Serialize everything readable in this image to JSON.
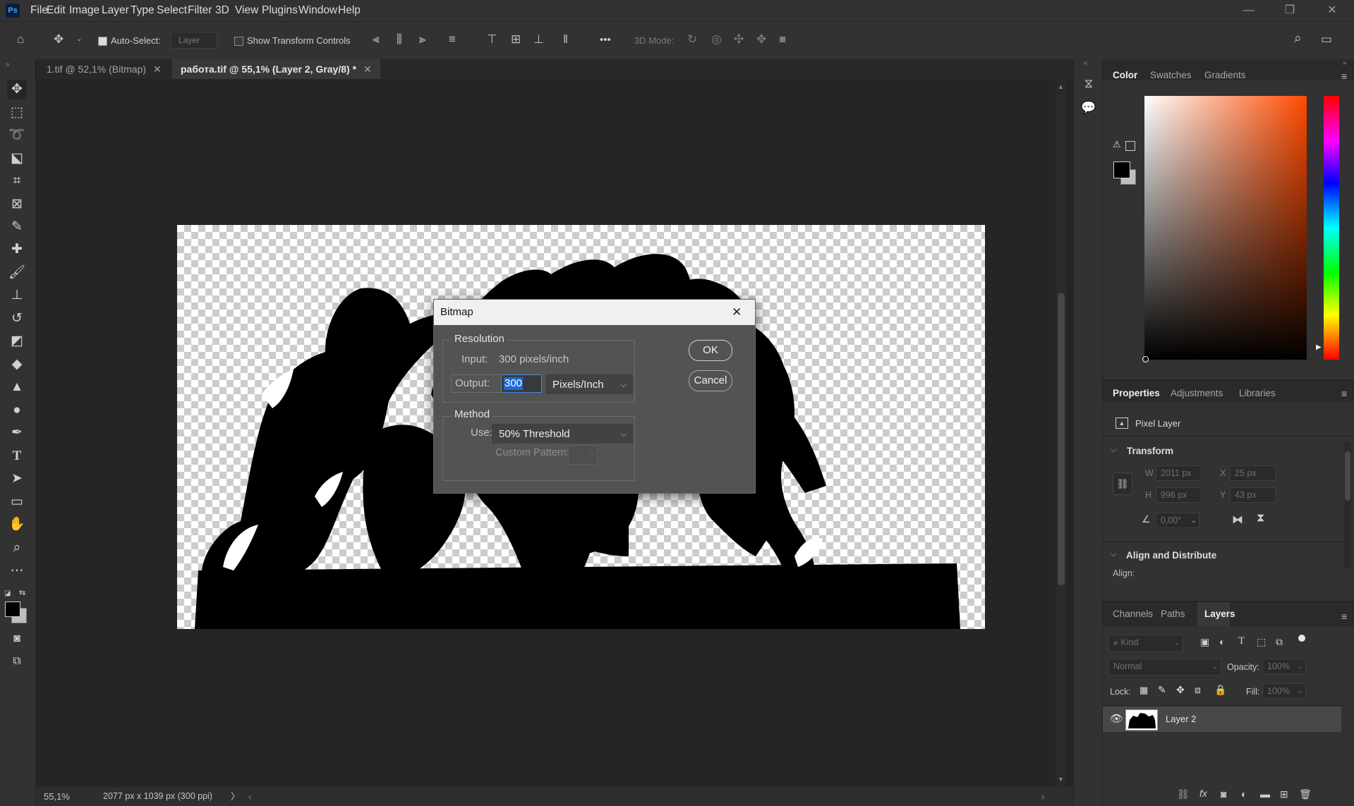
{
  "app": {
    "logo": "Ps"
  },
  "menu": [
    "File",
    "Edit",
    "Image",
    "Layer",
    "Type",
    "Select",
    "Filter",
    "3D",
    "View",
    "Plugins",
    "Window",
    "Help"
  ],
  "window_controls": {
    "minimize": "—",
    "restore": "❐",
    "close": "✕"
  },
  "options": {
    "auto_select_label": "Auto-Select:",
    "auto_select_checked": true,
    "auto_select_target": "Layer",
    "show_transform_label": "Show Transform Controls",
    "show_transform_checked": false,
    "more": "•••",
    "mode_label": "3D Mode:"
  },
  "tabs": [
    {
      "label": "1.tif @ 52,1% (Bitmap)",
      "active": false
    },
    {
      "label": "работа.tif @ 55,1% (Layer 2, Gray/8) *",
      "active": true
    }
  ],
  "status": {
    "zoom": "55,1%",
    "doc_info": "2077 px x 1039 px (300 ppi)",
    "arrow": "〉"
  },
  "dialog": {
    "title": "Bitmap",
    "resolution_title": "Resolution",
    "input_label": "Input:",
    "input_value": "300 pixels/inch",
    "output_label": "Output:",
    "output_value": "300",
    "output_unit": "Pixels/Inch",
    "method_title": "Method",
    "use_label": "Use:",
    "use_value": "50% Threshold",
    "custom_pattern_label": "Custom Pattern:",
    "ok": "OK",
    "cancel": "Cancel"
  },
  "color_panel": {
    "tabs": [
      "Color",
      "Swatches",
      "Gradients"
    ],
    "active": "Color",
    "hue_base": "#ff4a00"
  },
  "properties_panel": {
    "tabs": [
      "Properties",
      "Adjustments",
      "Libraries"
    ],
    "active": "Properties",
    "layer_type": "Pixel Layer",
    "transform_title": "Transform",
    "w_label": "W",
    "w_value": "2011 px",
    "h_label": "H",
    "h_value": "996 px",
    "x_label": "X",
    "x_value": "25 px",
    "y_label": "Y",
    "y_value": "43 px",
    "angle_value": "0,00°",
    "align_title": "Align and Distribute",
    "align_label": "Align:"
  },
  "layers_panel": {
    "tabs": [
      "Channels",
      "Paths",
      "Layers"
    ],
    "active": "Layers",
    "kind_placeholder": "Kind",
    "blend_mode": "Normal",
    "opacity_label": "Opacity:",
    "opacity_value": "100%",
    "lock_label": "Lock:",
    "fill_label": "Fill:",
    "fill_value": "100%",
    "layers": [
      {
        "name": "Layer 2",
        "visible": true,
        "selected": true
      }
    ]
  }
}
